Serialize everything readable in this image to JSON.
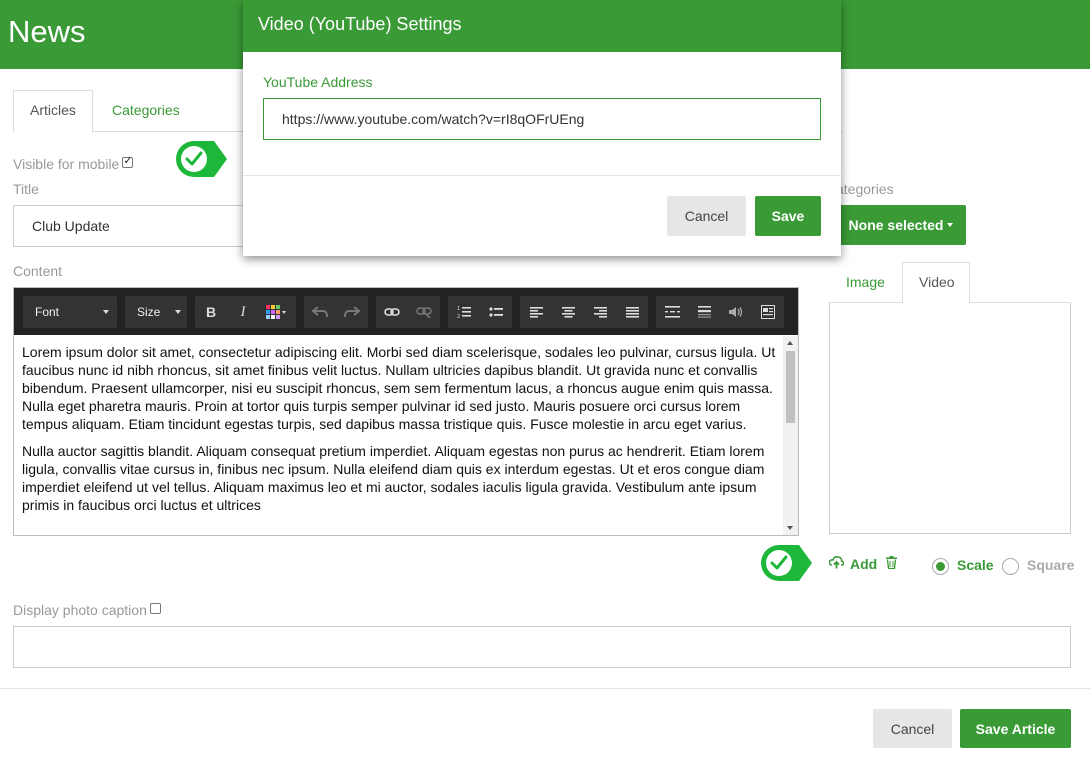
{
  "header": {
    "title": "News"
  },
  "tabs": {
    "articles": "Articles",
    "categories": "Categories"
  },
  "form": {
    "visible_mobile_label": "Visible for mobile",
    "title_label": "Title",
    "title_value": "Club Update",
    "content_label": "Content",
    "categories_label": "ategories",
    "categories_select": "None selected",
    "display_caption_label": "Display photo caption"
  },
  "toolbar": {
    "font": "Font",
    "size": "Size",
    "bold": "B",
    "italic": "I"
  },
  "content": {
    "paragraph1": "Lorem ipsum dolor sit amet, consectetur adipiscing elit. Morbi sed diam scelerisque, sodales leo pulvinar, cursus ligula. Ut faucibus nunc id nibh rhoncus, sit amet finibus velit luctus. Nullam ultricies dapibus blandit. Ut gravida nunc et convallis bibendum. Praesent ullamcorper, nisi eu suscipit rhoncus, sem sem fermentum lacus, a rhoncus augue enim quis massa. Nulla eget pharetra mauris. Proin at tortor quis turpis semper pulvinar id sed justo. Mauris posuere orci cursus lorem tempus aliquam. Etiam tincidunt egestas turpis, sed dapibus massa tristique quis. Fusce molestie in arcu eget varius.",
    "paragraph2": "Nulla auctor sagittis blandit. Aliquam consequat pretium imperdiet. Aliquam egestas non purus ac hendrerit. Etiam lorem ligula, convallis vitae cursus in, finibus nec ipsum. Nulla eleifend diam quis ex interdum egestas. Ut et eros congue diam imperdiet eleifend ut vel tellus. Aliquam maximus leo et mi auctor, sodales iaculis ligula gravida. Vestibulum ante ipsum primis in faucibus orci luctus et ultrices"
  },
  "media": {
    "tab_image": "Image",
    "tab_video": "Video",
    "add_label": "Add",
    "scale_label": "Scale",
    "square_label": "Square"
  },
  "footer": {
    "cancel": "Cancel",
    "save": "Save Article"
  },
  "modal": {
    "title": "Video (YouTube) Settings",
    "field_label": "YouTube Address",
    "field_value": "https://www.youtube.com/watch?v=rI8qOFrUEng",
    "cancel": "Cancel",
    "save": "Save"
  },
  "colors": {
    "accent": "#3a9a36",
    "badge": "#1db83a"
  }
}
